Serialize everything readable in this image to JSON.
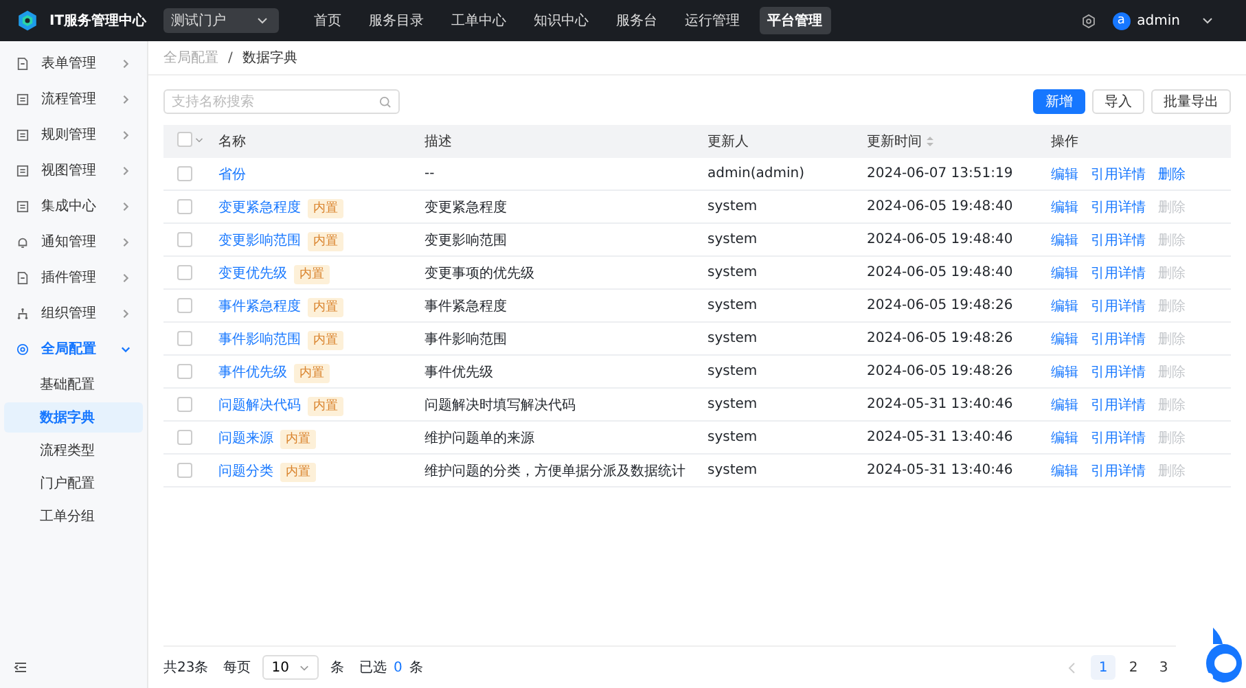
{
  "app": {
    "title": "IT服务管理中心",
    "portal": "测试门户"
  },
  "nav": [
    {
      "label": "首页",
      "selected": false
    },
    {
      "label": "服务目录",
      "selected": false
    },
    {
      "label": "工单中心",
      "selected": false
    },
    {
      "label": "知识中心",
      "selected": false
    },
    {
      "label": "服务台",
      "selected": false
    },
    {
      "label": "运行管理",
      "selected": false
    },
    {
      "label": "平台管理",
      "selected": true
    }
  ],
  "user": {
    "avatar": "a",
    "name": "admin"
  },
  "sidebar": {
    "items": [
      {
        "label": "表单管理",
        "kind": "doc",
        "expanded": false
      },
      {
        "label": "流程管理",
        "kind": "square",
        "expanded": false
      },
      {
        "label": "规则管理",
        "kind": "square",
        "expanded": false
      },
      {
        "label": "视图管理",
        "kind": "square",
        "expanded": false
      },
      {
        "label": "集成中心",
        "kind": "square",
        "expanded": false
      },
      {
        "label": "通知管理",
        "kind": "bell",
        "expanded": false
      },
      {
        "label": "插件管理",
        "kind": "doc",
        "expanded": false
      },
      {
        "label": "组织管理",
        "kind": "org",
        "expanded": false
      },
      {
        "label": "全局配置",
        "kind": "gear",
        "expanded": true,
        "children": [
          {
            "label": "基础配置",
            "selected": false
          },
          {
            "label": "数据字典",
            "selected": true
          },
          {
            "label": "流程类型",
            "selected": false
          },
          {
            "label": "门户配置",
            "selected": false
          },
          {
            "label": "工单分组",
            "selected": false
          }
        ]
      }
    ]
  },
  "breadcrumb": {
    "items": [
      "全局配置",
      "数据字典"
    ],
    "separator": "/"
  },
  "search": {
    "placeholder": "支持名称搜索"
  },
  "buttons": [
    {
      "label": "新增",
      "kind": "primary"
    },
    {
      "label": "导入",
      "kind": "default"
    },
    {
      "label": "批量导出",
      "kind": "default"
    }
  ],
  "table": {
    "select_all_checked": false,
    "columns": [
      "名称",
      "描述",
      "更新人",
      "更新时间",
      "操作"
    ],
    "rows": [
      {
        "name": "省份",
        "checked": false,
        "description": "--",
        "updater": "admin(admin)",
        "time": "2024-06-07 13:51:19",
        "actions": [
          {
            "label": "编辑",
            "disabled": false
          },
          {
            "label": "引用详情",
            "disabled": false
          },
          {
            "label": "删除",
            "disabled": false
          }
        ]
      },
      {
        "name": "变更紧急程度",
        "checked": false,
        "tag": "内置",
        "description": "变更紧急程度",
        "updater": "system",
        "time": "2024-06-05 19:48:40",
        "actions": [
          {
            "label": "编辑",
            "disabled": false
          },
          {
            "label": "引用详情",
            "disabled": false
          },
          {
            "label": "删除",
            "disabled": true
          }
        ]
      },
      {
        "name": "变更影响范围",
        "checked": false,
        "tag": "内置",
        "description": "变更影响范围",
        "updater": "system",
        "time": "2024-06-05 19:48:40",
        "actions": [
          {
            "label": "编辑",
            "disabled": false
          },
          {
            "label": "引用详情",
            "disabled": false
          },
          {
            "label": "删除",
            "disabled": true
          }
        ]
      },
      {
        "name": "变更优先级",
        "checked": false,
        "tag": "内置",
        "description": "变更事项的优先级",
        "updater": "system",
        "time": "2024-06-05 19:48:40",
        "actions": [
          {
            "label": "编辑",
            "disabled": false
          },
          {
            "label": "引用详情",
            "disabled": false
          },
          {
            "label": "删除",
            "disabled": true
          }
        ]
      },
      {
        "name": "事件紧急程度",
        "checked": false,
        "tag": "内置",
        "description": "事件紧急程度",
        "updater": "system",
        "time": "2024-06-05 19:48:26",
        "actions": [
          {
            "label": "编辑",
            "disabled": false
          },
          {
            "label": "引用详情",
            "disabled": false
          },
          {
            "label": "删除",
            "disabled": true
          }
        ]
      },
      {
        "name": "事件影响范围",
        "checked": false,
        "tag": "内置",
        "description": "事件影响范围",
        "updater": "system",
        "time": "2024-06-05 19:48:26",
        "actions": [
          {
            "label": "编辑",
            "disabled": false
          },
          {
            "label": "引用详情",
            "disabled": false
          },
          {
            "label": "删除",
            "disabled": true
          }
        ]
      },
      {
        "name": "事件优先级",
        "checked": false,
        "tag": "内置",
        "description": "事件优先级",
        "updater": "system",
        "time": "2024-06-05 19:48:26",
        "actions": [
          {
            "label": "编辑",
            "disabled": false
          },
          {
            "label": "引用详情",
            "disabled": false
          },
          {
            "label": "删除",
            "disabled": true
          }
        ]
      },
      {
        "name": "问题解决代码",
        "checked": false,
        "tag": "内置",
        "description": "问题解决时填写解决代码",
        "updater": "system",
        "time": "2024-05-31 13:40:46",
        "actions": [
          {
            "label": "编辑",
            "disabled": false
          },
          {
            "label": "引用详情",
            "disabled": false
          },
          {
            "label": "删除",
            "disabled": true
          }
        ]
      },
      {
        "name": "问题来源",
        "checked": false,
        "tag": "内置",
        "description": "维护问题单的来源",
        "updater": "system",
        "time": "2024-05-31 13:40:46",
        "actions": [
          {
            "label": "编辑",
            "disabled": false
          },
          {
            "label": "引用详情",
            "disabled": false
          },
          {
            "label": "删除",
            "disabled": true
          }
        ]
      },
      {
        "name": "问题分类",
        "checked": false,
        "tag": "内置",
        "description": "维护问题的分类，方便单据分派及数据统计",
        "updater": "system",
        "time": "2024-05-31 13:40:46",
        "actions": [
          {
            "label": "编辑",
            "disabled": false
          },
          {
            "label": "引用详情",
            "disabled": false
          },
          {
            "label": "删除",
            "disabled": true
          }
        ]
      }
    ]
  },
  "footer": {
    "total": "共23条",
    "per_page_label": "每页",
    "page_size": "10",
    "unit": "条",
    "selected_label": "已选",
    "selected_count": "0",
    "selected_unit": "条"
  },
  "pagination": {
    "prev_disabled": true,
    "pages": [
      {
        "label": "1",
        "selected": true
      },
      {
        "label": "2",
        "selected": false
      },
      {
        "label": "3",
        "selected": false
      }
    ]
  }
}
